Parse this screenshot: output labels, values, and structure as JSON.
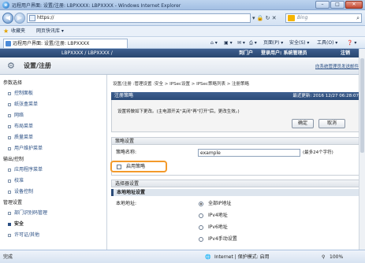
{
  "window": {
    "title": "远程用户界面: 设置/注册: LBPXXXX: LBPXXXX - Windows Internet Explorer",
    "min": "–",
    "max": "□",
    "close": "✕"
  },
  "browser": {
    "back": "◀",
    "forward": "▶",
    "url": "https://",
    "url_tools": "▾ 🔒 ↻ ✕",
    "search_placeholder": "Bing",
    "search_icon": "⌕",
    "favorites_label": "收藏夹",
    "suggested_sites": "网页快讯库 ▾",
    "tab_title": "远程用户界面: 设置/注册: LBPXXXX",
    "cmd_home": "⌂ ▾",
    "cmd_feeds": "▣ ▾",
    "cmd_mail": "✉ ▾",
    "cmd_print": "⎙ ▾",
    "cmd_page": "页面(P) ▾",
    "cmd_safety": "安全(S) ▾",
    "cmd_tools": "工具(O) ▾",
    "cmd_help": "❓ ▾"
  },
  "ui": {
    "device_name": "LBPXXXX / LBPXXXX /",
    "portal_link": "到门户",
    "login_user": "登录用户: 系统管理员",
    "logout_link": "注销",
    "page_title": "设置/注册",
    "admin_mail_link": "向系统管理员发送邮件"
  },
  "sidebar": {
    "sections": [
      {
        "label": "参数选择",
        "items": [
          "控制面板",
          "纸张盒菜单",
          "网络",
          "布局菜单",
          "质量菜单",
          "用户维护菜单"
        ]
      },
      {
        "label": "输出/控制",
        "items": [
          "应用程序菜单",
          "校准",
          "设备控制"
        ]
      },
      {
        "label": "管理设置",
        "items": [
          "部门识别码管理",
          "安全",
          "许可证/其他"
        ]
      }
    ],
    "active_item": "安全"
  },
  "main": {
    "breadcrumb": "设置/注册 :管理设置 :安全 > IPSec设置 > IPSec策略列表 > 注册策略",
    "panel_title": "注册策略",
    "last_updated": "最近更新: 2016 12/27 06:28:07",
    "notice": "设置将做如下更改。(主电源开关\"关闭\"再\"打开\"后，更改生效。)",
    "ok_button": "确定",
    "cancel_button": "取消",
    "policy_section": "策略设置",
    "policy_name_label": "策略名称:",
    "policy_name_value": "example",
    "policy_name_hint": "(最多24个字符)",
    "enable_policy_label": "启用策略",
    "selector_section": "选择器设置",
    "local_address_section": "本地地址设置",
    "local_address_label": "本地地址:",
    "local_address_options": [
      "全部IP地址",
      "IPv4地址",
      "IPv6地址",
      "IPv4手动设置"
    ],
    "local_address_selected": 0
  },
  "status": {
    "left": "完成",
    "zone": "Internet | 保护模式: 启用",
    "zoom": "100%"
  }
}
